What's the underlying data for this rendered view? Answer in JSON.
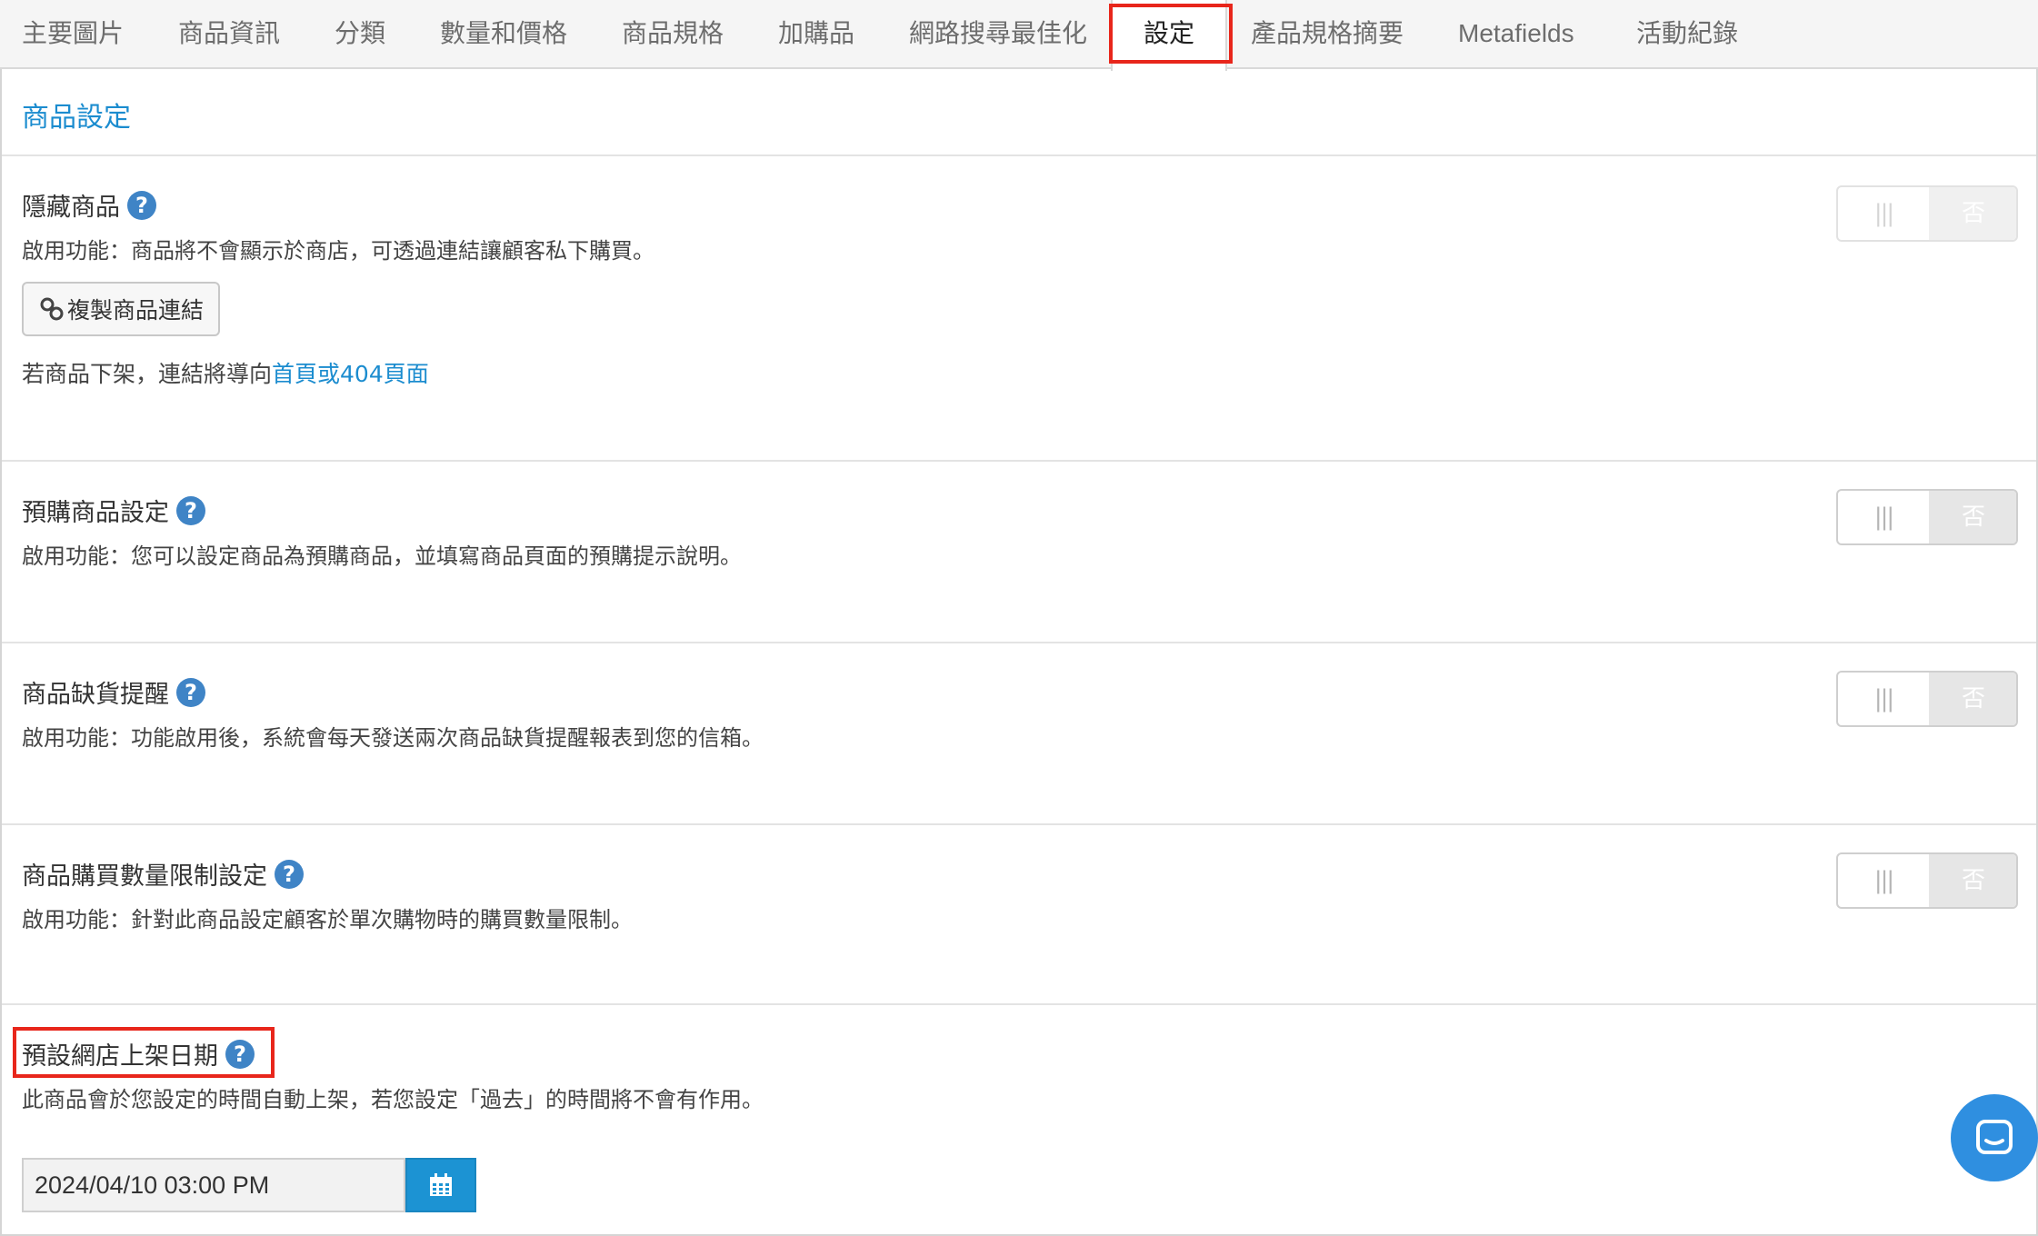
{
  "tabs": [
    {
      "label": "主要圖片"
    },
    {
      "label": "商品資訊"
    },
    {
      "label": "分類"
    },
    {
      "label": "數量和價格"
    },
    {
      "label": "商品規格"
    },
    {
      "label": "加購品"
    },
    {
      "label": "網路搜尋最佳化"
    },
    {
      "label": "設定",
      "active": true
    },
    {
      "label": "產品規格摘要"
    },
    {
      "label": "Metafields"
    },
    {
      "label": "活動紀錄"
    }
  ],
  "section_title": "商品設定",
  "hidden_product": {
    "title": "隱藏商品",
    "desc": "啟用功能：商品將不會顯示於商店，可透過連結讓顧客私下購買。",
    "copy_button": "複製商品連結",
    "redirect_prefix": "若商品下架，連結將導向",
    "redirect_link": "首頁或404頁面",
    "toggle_on": "|||",
    "toggle_off": "否"
  },
  "preorder": {
    "title": "預購商品設定",
    "desc": "啟用功能：您可以設定商品為預購商品，並填寫商品頁面的預購提示說明。",
    "toggle_on": "|||",
    "toggle_off": "否"
  },
  "stock_alert": {
    "title": "商品缺貨提醒",
    "desc": "啟用功能：功能啟用後，系統會每天發送兩次商品缺貨提醒報表到您的信箱。",
    "toggle_on": "|||",
    "toggle_off": "否"
  },
  "purchase_limit": {
    "title": "商品購買數量限制設定",
    "desc": "啟用功能：針對此商品設定顧客於單次購物時的購買數量限制。",
    "toggle_on": "|||",
    "toggle_off": "否"
  },
  "publish_date": {
    "title": "預設網店上架日期",
    "desc": "此商品會於您設定的時間自動上架，若您設定「過去」的時間將不會有作用。",
    "value": "2024/04/10 03:00 PM"
  },
  "colors": {
    "accent": "#1b8ccf",
    "help_icon": "#3f84c6",
    "highlight": "#e8261b",
    "chat": "#2f8fe0"
  },
  "icons": {
    "help": "question-circle-icon",
    "link": "link-icon",
    "calendar": "calendar-icon",
    "chat": "chat-icon"
  }
}
